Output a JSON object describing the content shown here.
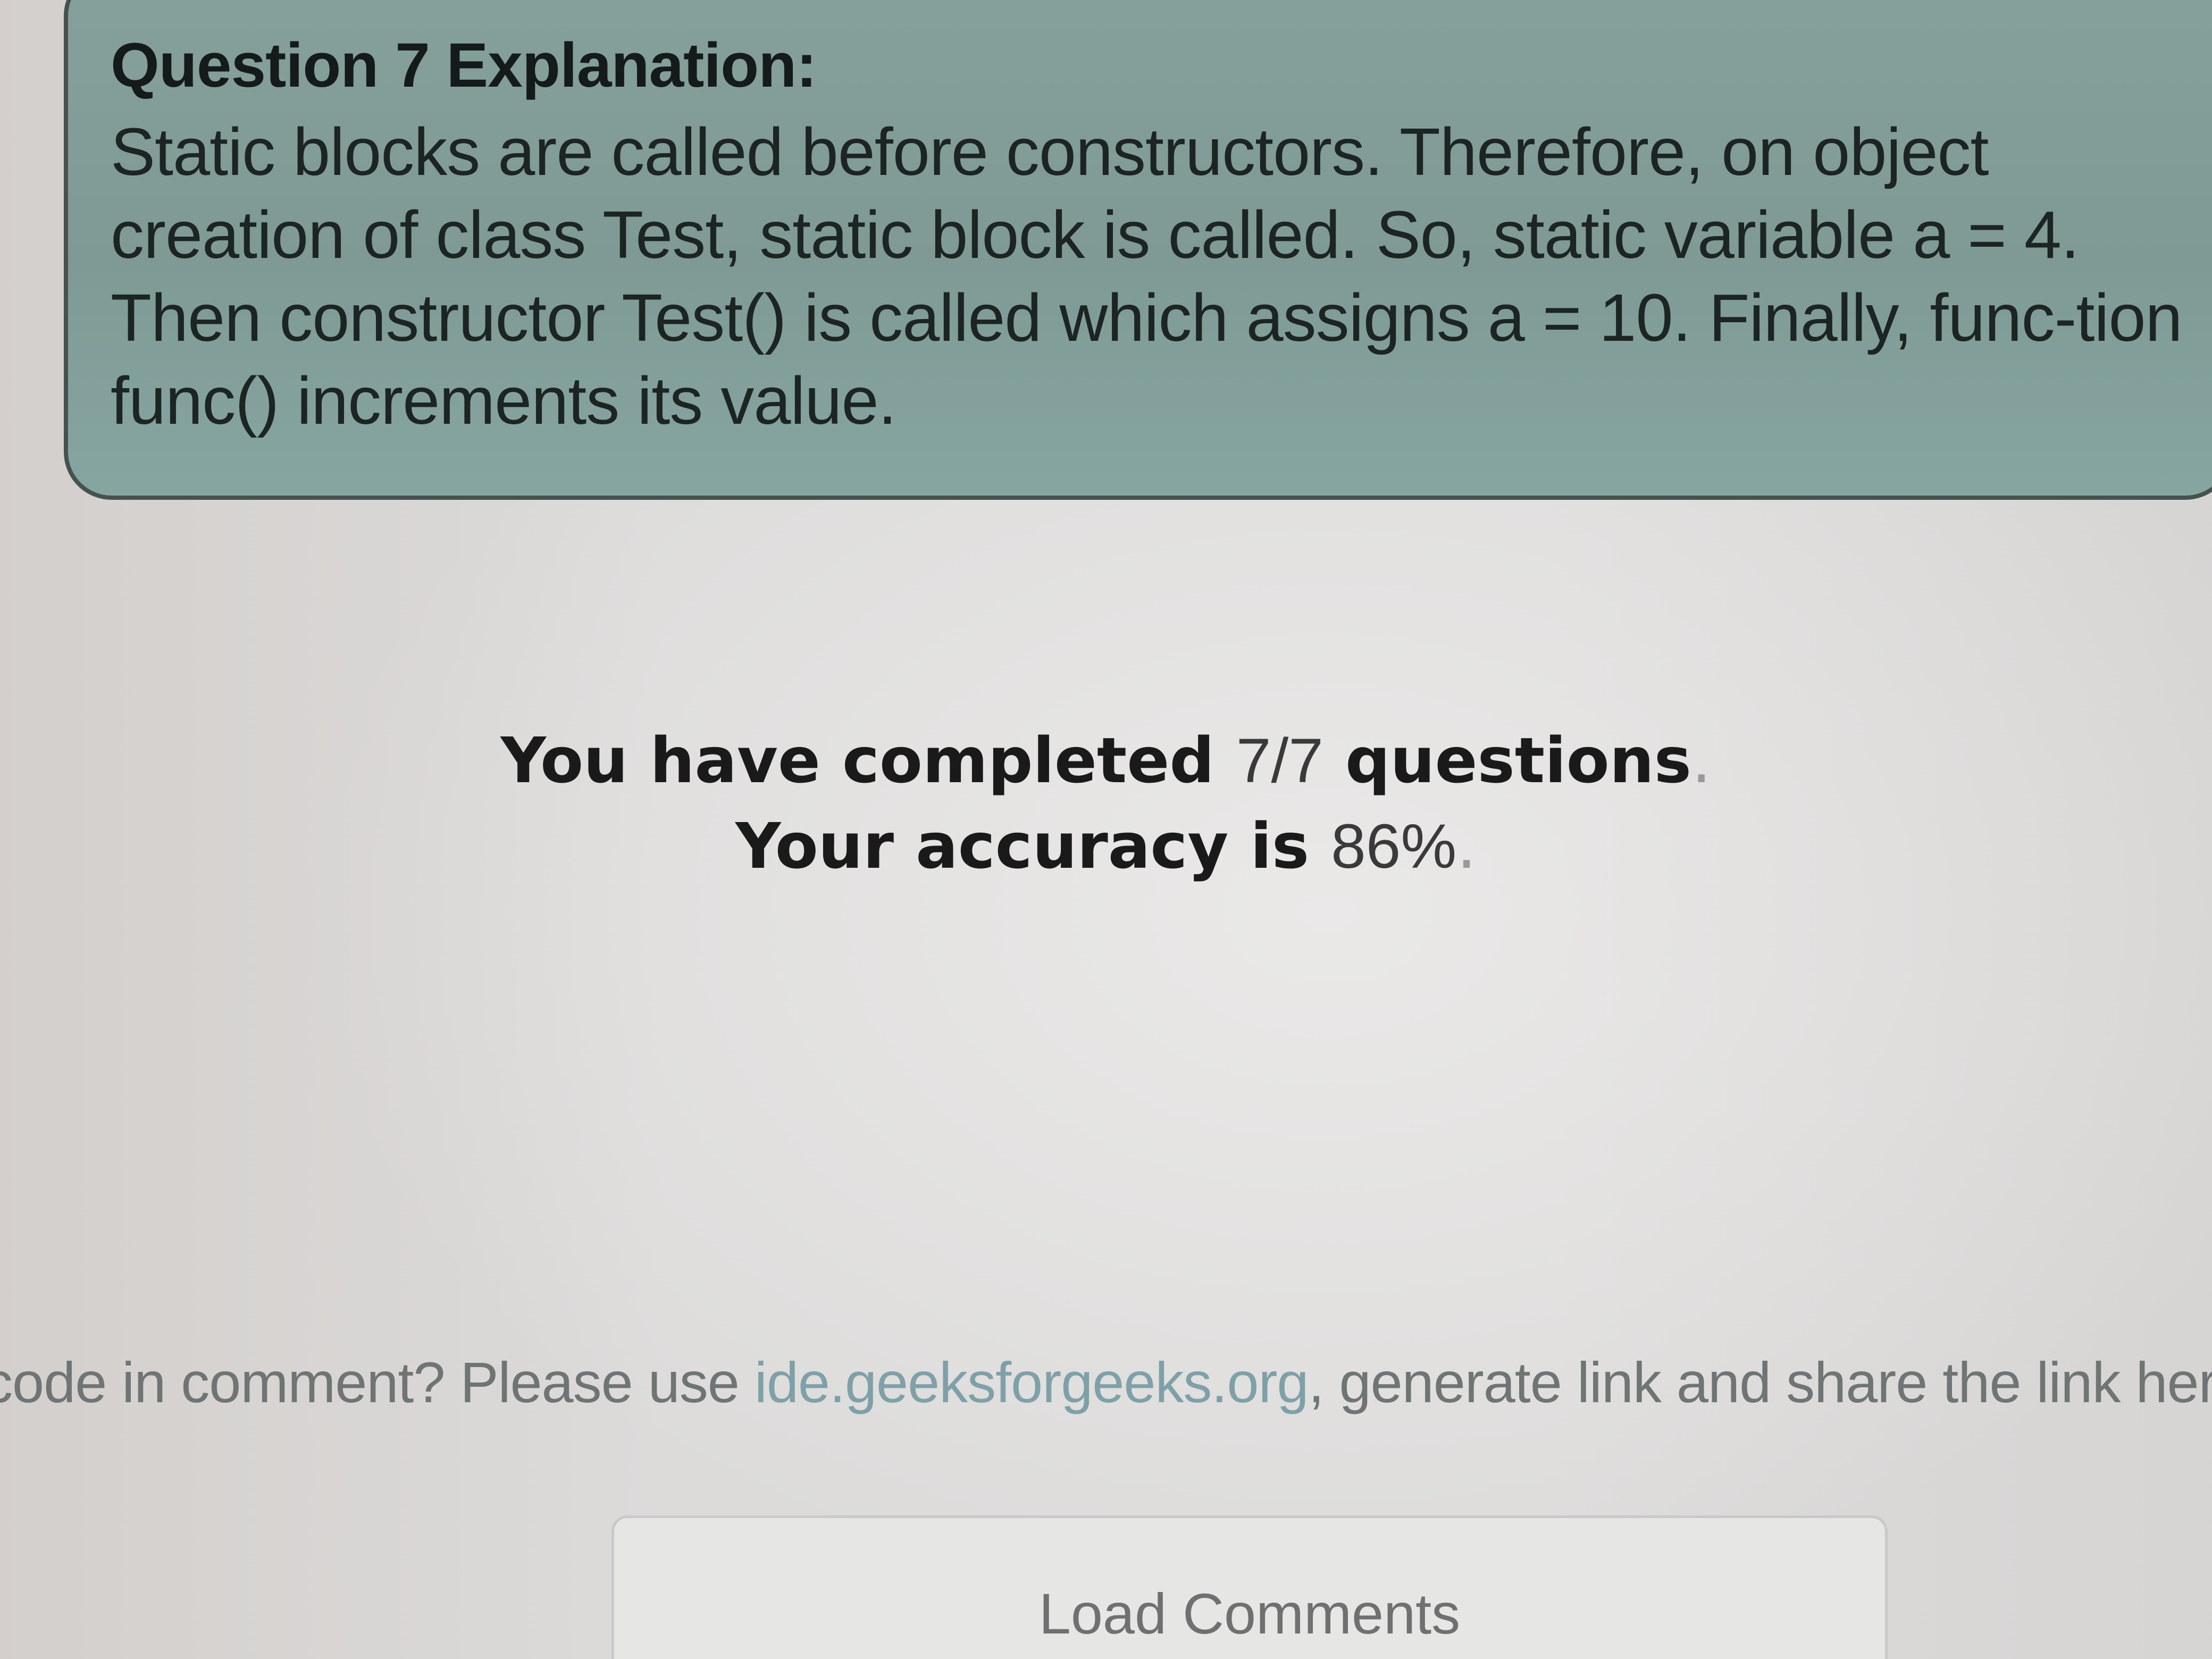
{
  "explanation": {
    "title": "Question 7 Explanation:",
    "text": "Static blocks are called before constructors. Therefore, on object creation of class Test, static block is called. So, static variable a = 4. Then constructor Test() is called which assigns a = 10. Finally, func-tion func() increments its value."
  },
  "result": {
    "completed_prefix": "You have completed",
    "completed_value": "7/7",
    "completed_suffix": "questions",
    "accuracy_prefix": "Your accuracy is",
    "accuracy_value": "86%"
  },
  "comment_prompt": {
    "prefix": "code in comment? Please use",
    "link": "ide.geeksforgeeks.org",
    "suffix": ", generate link and share the link here"
  },
  "load_comments_label": "Load Comments"
}
